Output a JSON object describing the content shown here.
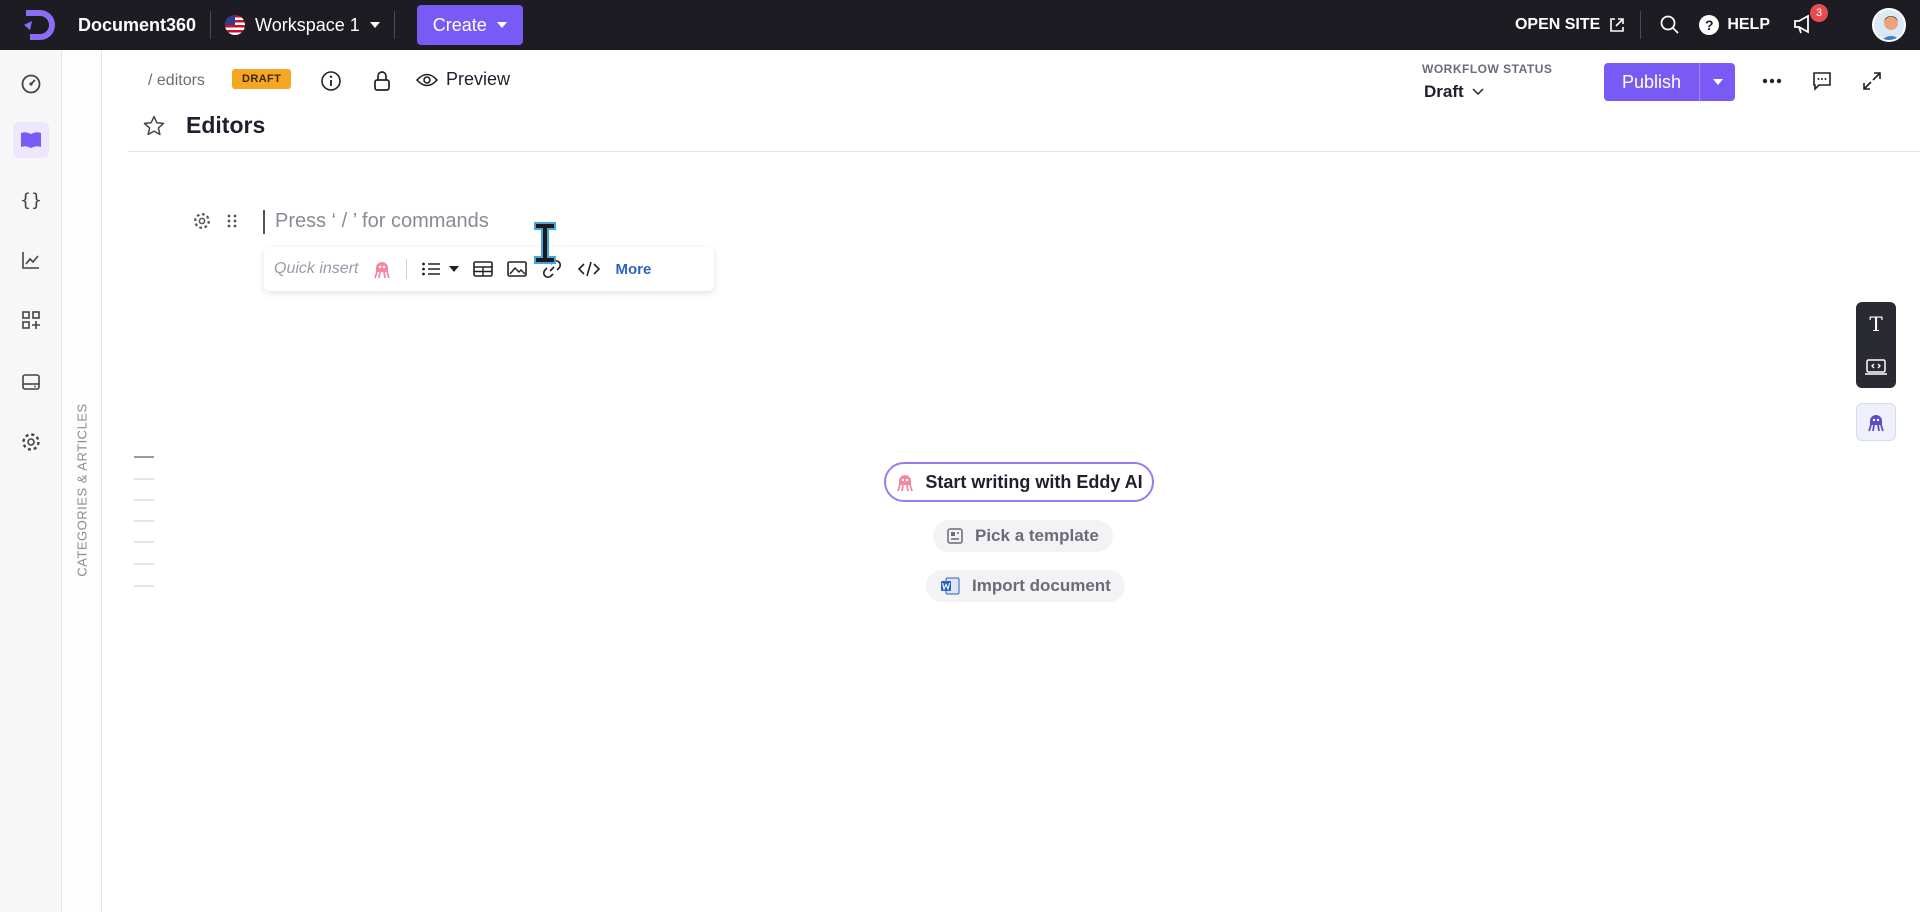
{
  "topbar": {
    "brand": "Document360",
    "workspace": "Workspace 1",
    "create_label": "Create",
    "open_site_label": "OPEN SITE",
    "help_label": "HELP",
    "notification_count": "3"
  },
  "article": {
    "breadcrumb": "/ editors",
    "status_badge": "DRAFT",
    "preview_label": "Preview",
    "title": "Editors"
  },
  "workflow": {
    "label": "WORKFLOW STATUS",
    "value": "Draft"
  },
  "actions": {
    "publish_label": "Publish"
  },
  "sidebar": {
    "panel_label": "CATEGORIES & ARTICLES"
  },
  "editor": {
    "placeholder": "Press ‘ / ’ for commands",
    "quick_insert_label": "Quick insert",
    "more_label": "More"
  },
  "empty_state": {
    "eddy_label": "Start writing with Eddy AI",
    "template_label": "Pick a template",
    "import_label": "Import document"
  },
  "colors": {
    "accent": "#7a5af5",
    "topbar_bg": "#1c1c22",
    "draft_badge": "#f5a623",
    "link": "#2f62c8"
  }
}
